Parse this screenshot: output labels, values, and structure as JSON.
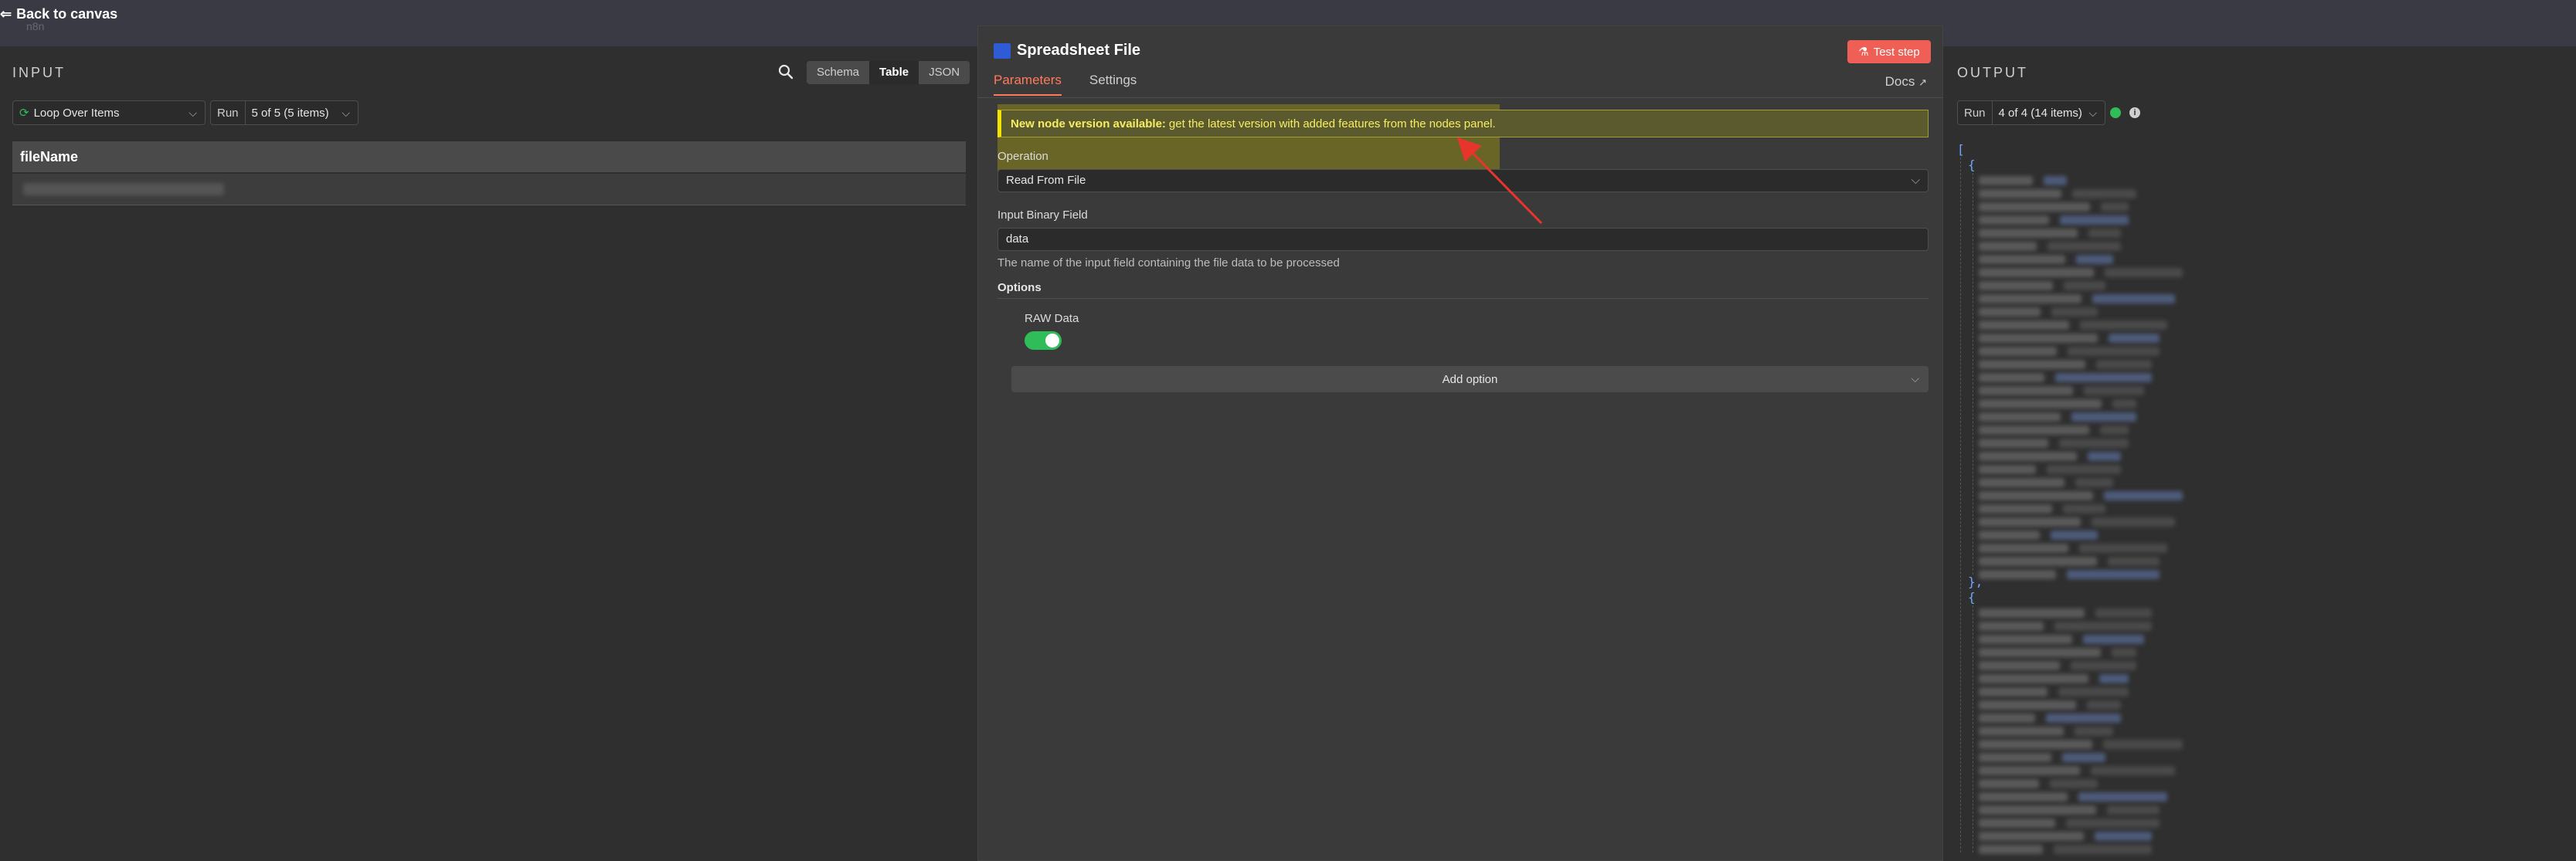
{
  "topbar": {
    "back_label": "Back to canvas",
    "logo_text": "n8n"
  },
  "input": {
    "title": "INPUT",
    "view_tabs": [
      "Schema",
      "Table",
      "JSON"
    ],
    "active_view": "Table",
    "source_node": "Loop Over Items",
    "run_label": "Run",
    "run_value": "5 of 5 (5 items)",
    "table": {
      "columns": [
        "fileName"
      ]
    }
  },
  "node": {
    "title": "Spreadsheet File",
    "test_button": "Test step",
    "tabs": [
      "Parameters",
      "Settings"
    ],
    "active_tab": "Parameters",
    "docs_label": "Docs",
    "notice_bold": "New node version available:",
    "notice_text": "get the latest version with added features from the nodes panel.",
    "operation_label": "Operation",
    "operation_value": "Read From File",
    "binary_field_label": "Input Binary Field",
    "binary_field_value": "data",
    "binary_field_hint": "The name of the input field containing the file data to be processed",
    "options_title": "Options",
    "raw_data_label": "RAW Data",
    "raw_data_enabled": true,
    "add_option_label": "Add option"
  },
  "output": {
    "title": "OUTPUT",
    "run_label": "Run",
    "run_value": "4 of 4 (14 items)",
    "json_open": "[",
    "obj_open": "{",
    "obj_close": "},"
  },
  "colors": {
    "accent": "#ff7a5a",
    "test_button": "#ef5f55",
    "success": "#2ebd59",
    "notice": "#f6ee62",
    "annotation_arrow": "#e8352b"
  }
}
